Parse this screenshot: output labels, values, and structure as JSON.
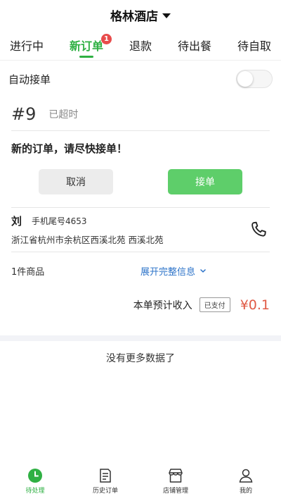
{
  "header": {
    "store_name": "格林酒店"
  },
  "tabs": [
    {
      "label": "进行中",
      "active": false
    },
    {
      "label": "新订单",
      "active": true,
      "badge": "1"
    },
    {
      "label": "退款",
      "active": false
    },
    {
      "label": "待出餐",
      "active": false
    },
    {
      "label": "待自取",
      "active": false
    }
  ],
  "auto_accept": {
    "label": "自动接单",
    "enabled": false
  },
  "order": {
    "number": "#9",
    "status": "已超时",
    "notice": "新的订单，请尽快接单！",
    "cancel_label": "取消",
    "accept_label": "接单",
    "customer": {
      "name": "刘",
      "phone": "手机尾号4653",
      "address": "浙江省杭州市余杭区西溪北苑 西溪北苑"
    },
    "goods_count": "1件商品",
    "expand_label": "展开完整信息",
    "income_label": "本单预计收入",
    "paid_badge": "已支付",
    "income_amount": "¥0.1"
  },
  "footer_message": "没有更多数据了",
  "bottom_nav": [
    {
      "label": "待处理",
      "icon": "clock-icon",
      "active": true
    },
    {
      "label": "历史订单",
      "icon": "document-icon",
      "active": false
    },
    {
      "label": "店铺管理",
      "icon": "store-icon",
      "active": false
    },
    {
      "label": "我的",
      "icon": "person-icon",
      "active": false
    }
  ],
  "colors": {
    "accent": "#2fb043",
    "accept_button": "#5ece6a",
    "price": "#e05a45",
    "link": "#2e74c9",
    "badge": "#e84b4b"
  }
}
